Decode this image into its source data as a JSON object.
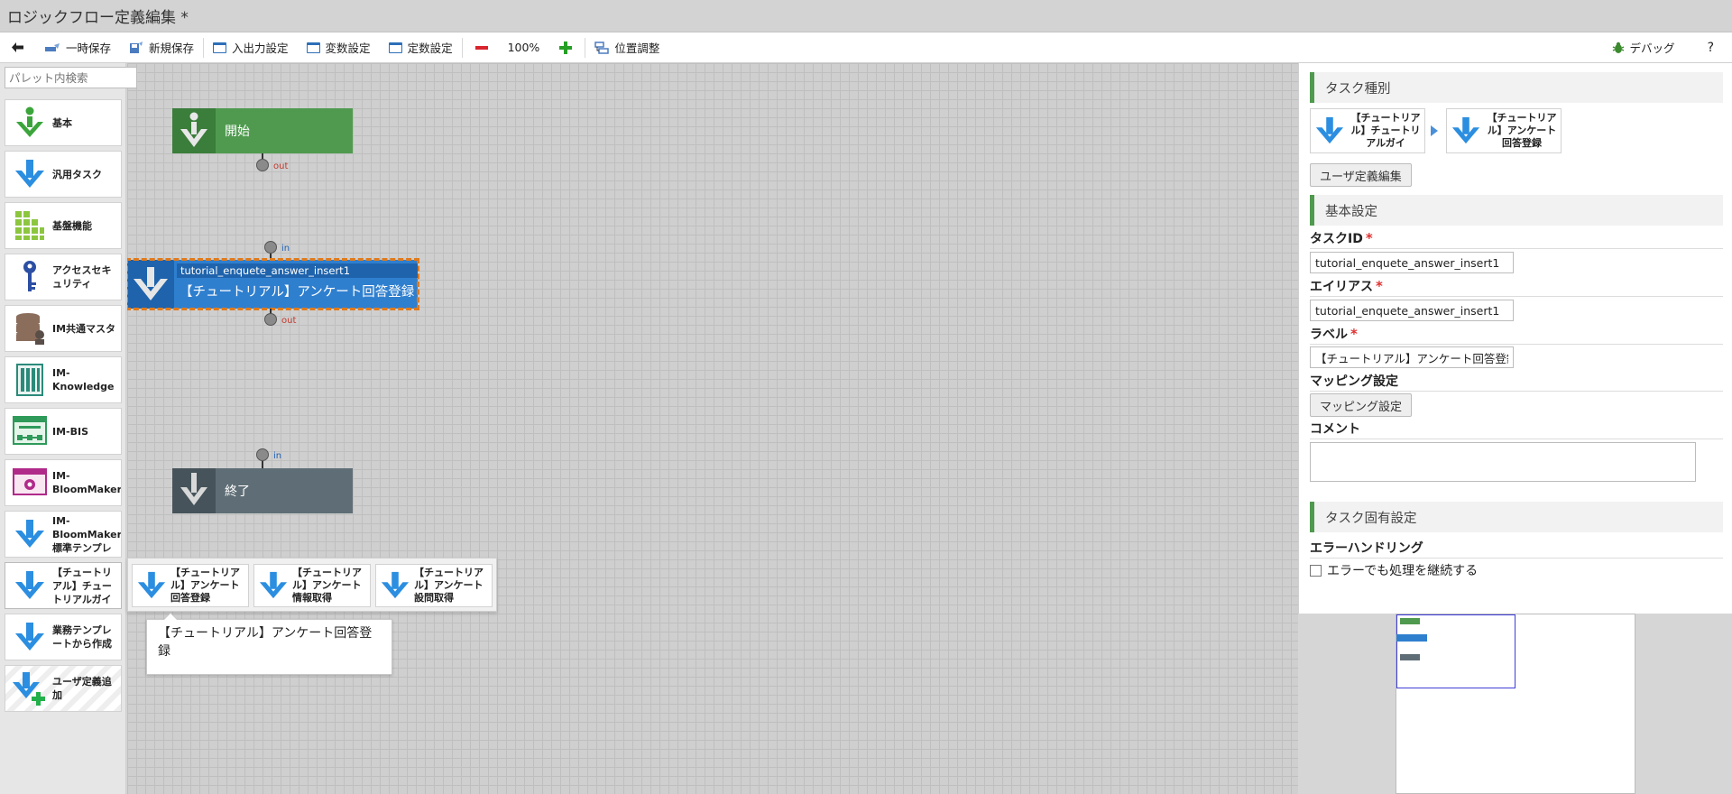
{
  "window": {
    "title": "ロジックフロー定義編集 *"
  },
  "toolbar": {
    "back": "",
    "temp_save": "一時保存",
    "new_save": "新規保存",
    "io_settings": "入出力設定",
    "var_settings": "変数設定",
    "const_settings": "定数設定",
    "zoom": "100%",
    "position_adjust": "位置調整",
    "debug": "デバッグ",
    "help": "?"
  },
  "palette": {
    "search_placeholder": "パレット内検索",
    "items": [
      {
        "label": "基本",
        "icon": "green-arrow-down-icon"
      },
      {
        "label": "汎用タスク",
        "icon": "blue-arrow-down-icon"
      },
      {
        "label": "基盤機能",
        "icon": "green-grid-icon"
      },
      {
        "label": "アクセスセキュリティ",
        "icon": "key-icon"
      },
      {
        "label": "IM共通マスタ",
        "icon": "database-icon"
      },
      {
        "label": "IM-Knowledge",
        "icon": "book-icon"
      },
      {
        "label": "IM-BIS",
        "icon": "workflow-icon"
      },
      {
        "label": "IM-BloomMaker",
        "icon": "bloommaker-icon"
      },
      {
        "label": "IM-BloomMaker標準テンプレ",
        "icon": "blue-arrow-down-icon"
      },
      {
        "label": "【チュートリアル】チュートリアルガイ",
        "icon": "blue-arrow-down-icon"
      },
      {
        "label": "業務テンプレートから作成",
        "icon": "blue-arrow-down-icon"
      },
      {
        "label": "ユーザ定義追加",
        "icon": "blue-arrow-plus-icon"
      }
    ],
    "flyout": [
      {
        "label": "【チュートリアル】アンケート回答登録"
      },
      {
        "label": "【チュートリアル】アンケート情報取得"
      },
      {
        "label": "【チュートリアル】アンケート設問取得"
      }
    ],
    "tooltip": "【チュートリアル】アンケート回答登録"
  },
  "canvas": {
    "start_label": "開始",
    "end_label": "終了",
    "task_id": "tutorial_enquete_answer_insert1",
    "task_label": "【チュートリアル】アンケート回答登録",
    "port_out": "out",
    "port_in": "in"
  },
  "panel": {
    "task_type_header": "タスク種別",
    "type_cards": [
      {
        "label": "【チュートリアル】チュートリアルガイ"
      },
      {
        "label": "【チュートリアル】アンケート回答登録"
      }
    ],
    "user_def_edit": "ユーザ定義編集",
    "basic_header": "基本設定",
    "task_id_label": "タスクID",
    "task_id_value": "tutorial_enquete_answer_insert1",
    "alias_label": "エイリアス",
    "alias_value": "tutorial_enquete_answer_insert1",
    "label_label": "ラベル",
    "label_value": "【チュートリアル】アンケート回答登録",
    "mapping_label": "マッピング設定",
    "mapping_button": "マッピング設定",
    "comment_label": "コメント",
    "required_mark": "*",
    "specific_header": "タスク固有設定",
    "error_handling_label": "エラーハンドリング",
    "continue_on_error": "エラーでも処理を継続する"
  },
  "colors": {
    "start_green": "#4f9a4f",
    "task_blue": "#2f7fcf",
    "end_gray": "#5f6e76",
    "selection_orange": "#e07a1a",
    "required_red": "#e03030"
  }
}
